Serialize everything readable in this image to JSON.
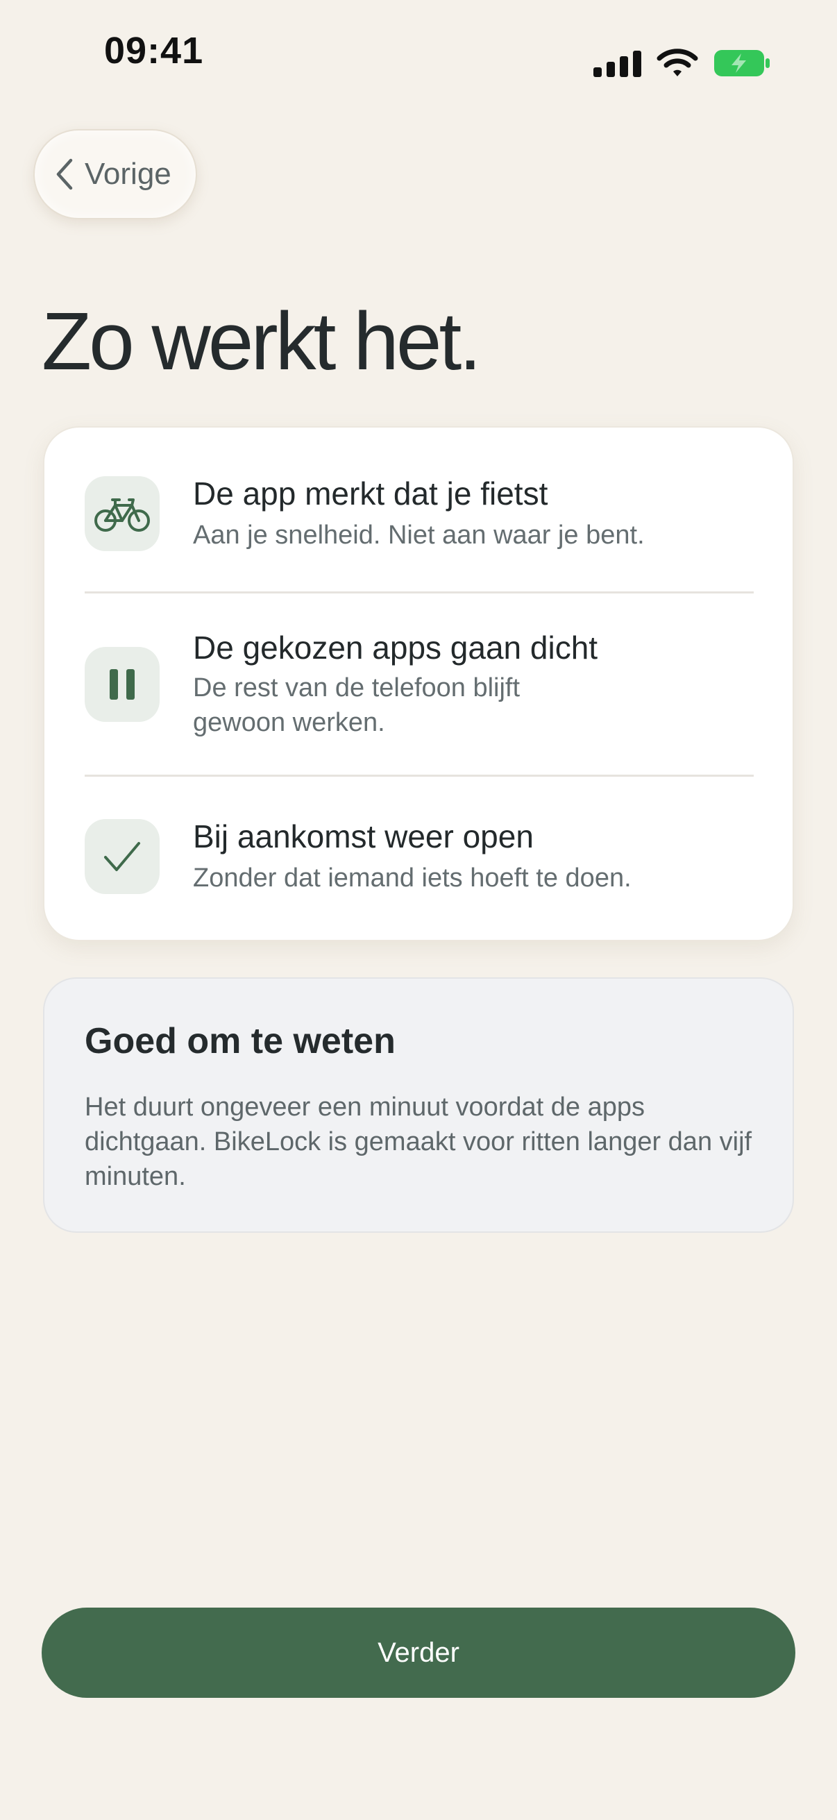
{
  "status_bar": {
    "time": "09:41",
    "battery_color": "#34c759"
  },
  "nav": {
    "back_label": "Vorige"
  },
  "page": {
    "title": "Zo werkt het."
  },
  "steps": [
    {
      "icon": "bicycle-icon",
      "title": "De app merkt dat je fietst",
      "subtitle": "Aan je snelheid. Niet aan waar je bent."
    },
    {
      "icon": "pause-icon",
      "title": "De gekozen apps gaan dicht",
      "subtitle": "De rest van de telefoon blijft gewoon werken."
    },
    {
      "icon": "checkmark-icon",
      "title": "Bij aankomst weer open",
      "subtitle": "Zonder dat iemand iets hoeft te doen."
    }
  ],
  "info": {
    "title": "Goed om te weten",
    "body": "Het duurt ongeveer een minuut voordat de apps dichtgaan. BikeLock is gemaakt voor ritten langer dan vijf minuten."
  },
  "footer": {
    "continue_label": "Verder"
  },
  "colors": {
    "accent": "#436b4e",
    "background": "#f5f1ea",
    "icon_tint": "#3f6a4b"
  }
}
